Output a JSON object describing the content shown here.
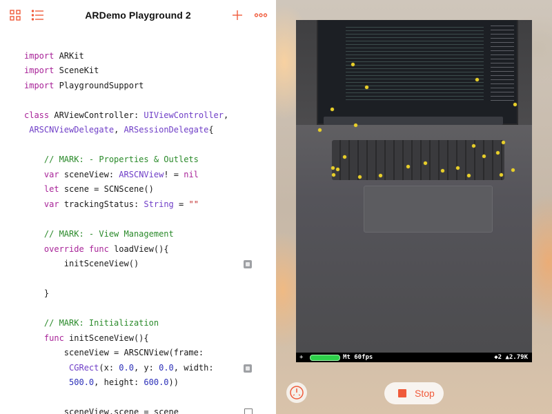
{
  "toolbar": {
    "title": "ARDemo Playground 2",
    "accent": "#f05a3a",
    "icons": [
      "grid-icon",
      "list-icon",
      "add-icon",
      "more-icon"
    ]
  },
  "code": {
    "lines": [
      "import ARKit",
      "import SceneKit",
      "import PlaygroundSupport",
      "",
      "class ARViewController: UIViewController,",
      " ARSCNViewDelegate, ARSessionDelegate{",
      "",
      "    // MARK: - Properties & Outlets",
      "    var sceneView: ARSCNView! = nil",
      "    let scene = SCNScene()",
      "    var trackingStatus: String = \"\"",
      "",
      "    // MARK: - View Management",
      "    override func loadView(){",
      "        initSceneView()",
      "",
      "    }",
      "",
      "    // MARK: Initialization",
      "    func initSceneView(){",
      "        sceneView = ARSCNView(frame:",
      "         CGRect(x: 0.0, y: 0.0, width:",
      "         500.0, height: 600.0))",
      "",
      "        sceneView.scene = scene"
    ]
  },
  "live_view": {
    "stats": {
      "plus": "+",
      "fps": "Mt 60fps",
      "counts": "◆2 ▲2.79K"
    },
    "stop_label": "Stop"
  }
}
